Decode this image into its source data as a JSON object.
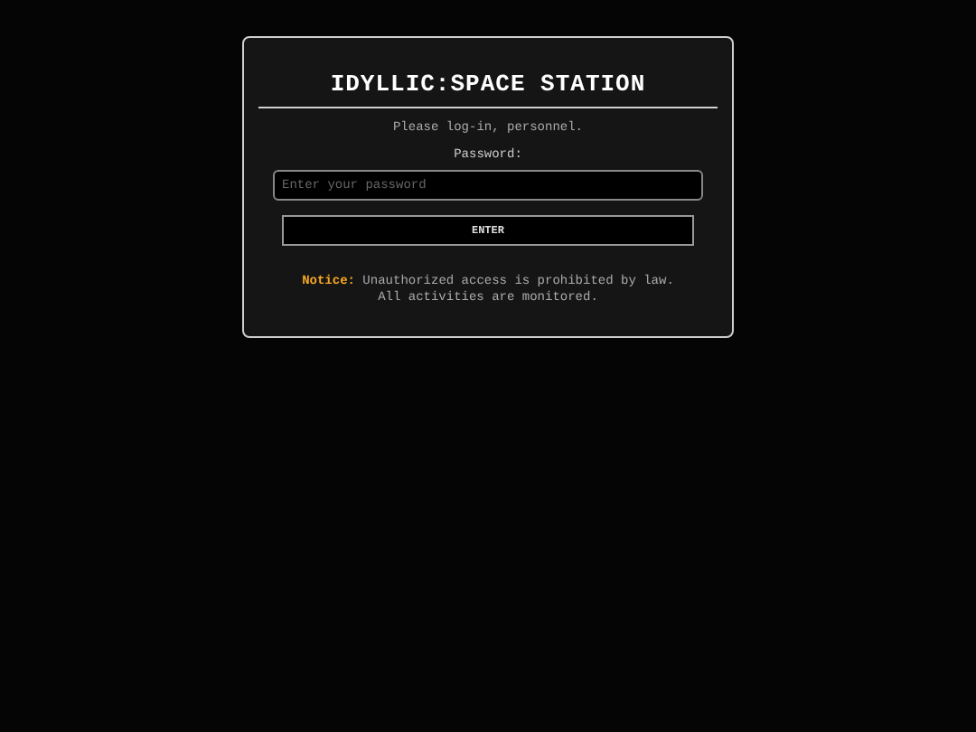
{
  "title": "IDYLLIC:SPACE STATION",
  "prompt": "Please log-in, personnel.",
  "password": {
    "label": "Password:",
    "placeholder": "Enter your password"
  },
  "button": "ENTER",
  "notice": "**Notice:** Unauthorized access is prohibited by law. All activities are monitored."
}
